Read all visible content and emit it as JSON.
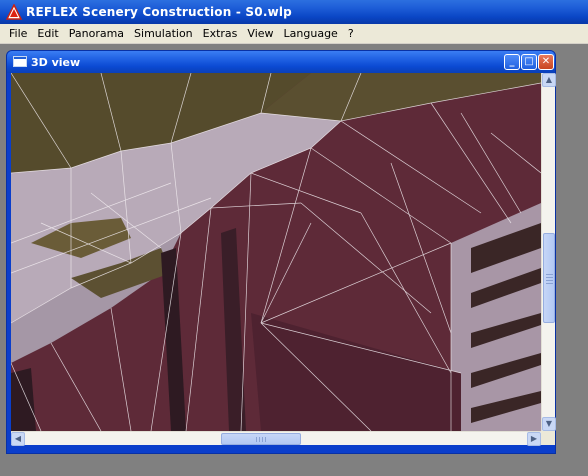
{
  "app": {
    "title": "REFLEX Scenery Construction - S0.wlp",
    "icon": "warning-triangle-icon"
  },
  "menu": {
    "items": [
      "File",
      "Edit",
      "Panorama",
      "Simulation",
      "Extras",
      "View",
      "Language",
      "?"
    ]
  },
  "view_window": {
    "title": "3D view",
    "buttons": {
      "minimize": "_",
      "maximize": "□",
      "close": "✕"
    }
  },
  "scrollbars": {
    "up_arrow": "▲",
    "down_arrow": "▼",
    "left_arrow": "◀",
    "right_arrow": "▶"
  },
  "colors": {
    "terrain_red": "#6b2d3e",
    "terrain_olive": "#5a5030",
    "terrain_gray": "#b4a8b4",
    "mesh_line": "#ffffff",
    "title_blue": "#0a46c6"
  }
}
